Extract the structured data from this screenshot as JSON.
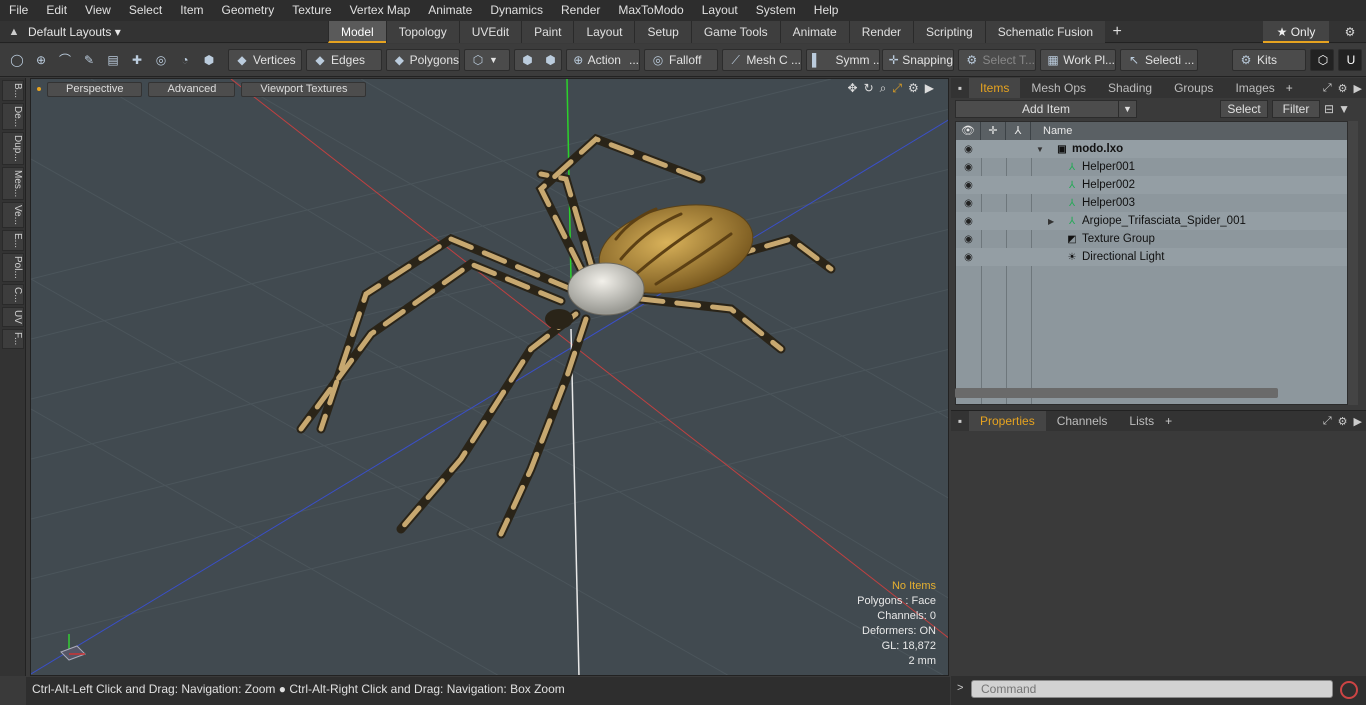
{
  "menu": [
    "File",
    "Edit",
    "View",
    "Select",
    "Item",
    "Geometry",
    "Texture",
    "Vertex Map",
    "Animate",
    "Dynamics",
    "Render",
    "MaxToModo",
    "Layout",
    "System",
    "Help"
  ],
  "layouts": {
    "dropdown": "Default Layouts ▾",
    "tabs": [
      "Model",
      "Topology",
      "UVEdit",
      "Paint",
      "Layout",
      "Setup",
      "Game Tools",
      "Animate",
      "Render",
      "Scripting",
      "Schematic Fusion"
    ],
    "active": "Model",
    "only_label": "★  Only"
  },
  "toolbar": {
    "vertices": "Vertices",
    "edges": "Edges",
    "polygons": "Polygons",
    "action": "Action",
    "falloff": "Falloff",
    "mesh": "Mesh C ...",
    "symm": "Symm ...",
    "snapping": "Snapping",
    "select_t": "Select T...",
    "work_plane": "Work Pl...",
    "selecti": "Selecti ...",
    "kits": "Kits"
  },
  "left_tabs": [
    "B...",
    "De...",
    "Dup...",
    "Mes...",
    "Ve...",
    "E...",
    "Pol...",
    "C...",
    "UV",
    "F..."
  ],
  "viewport": {
    "perspective": "Perspective",
    "advanced": "Advanced",
    "viewport_textures": "Viewport Textures",
    "stats": {
      "no_items": "No Items",
      "polygons": "Polygons : Face",
      "channels": "Channels: 0",
      "deformers": "Deformers: ON",
      "gl": "GL: 18,872",
      "scale": "2 mm"
    }
  },
  "status_text": "Ctrl-Alt-Left Click and Drag: Navigation: Zoom ● Ctrl-Alt-Right Click and Drag: Navigation: Box Zoom",
  "items_panel": {
    "tabs": [
      "Items",
      "Mesh Ops",
      "Shading",
      "Groups",
      "Images"
    ],
    "add_item": "Add Item",
    "select": "Select",
    "filter": "Filter",
    "name_col": "Name",
    "rows": [
      {
        "name": "modo.lxo",
        "icon": "scene-icon"
      },
      {
        "name": "Helper001",
        "icon": "locator-icon"
      },
      {
        "name": "Helper002",
        "icon": "locator-icon"
      },
      {
        "name": "Helper003",
        "icon": "locator-icon"
      },
      {
        "name": "Argiope_Trifasciata_Spider_001",
        "icon": "locator-icon"
      },
      {
        "name": "Texture Group",
        "icon": "texture-group-icon"
      },
      {
        "name": "Directional Light",
        "icon": "light-icon"
      }
    ]
  },
  "properties_panel": {
    "tabs": [
      "Properties",
      "Channels",
      "Lists"
    ]
  },
  "command": {
    "placeholder": "Command"
  },
  "colors": {
    "accent": "#e6a320",
    "viewport_bg": "#414a50",
    "list_bg": "#8d979d"
  }
}
